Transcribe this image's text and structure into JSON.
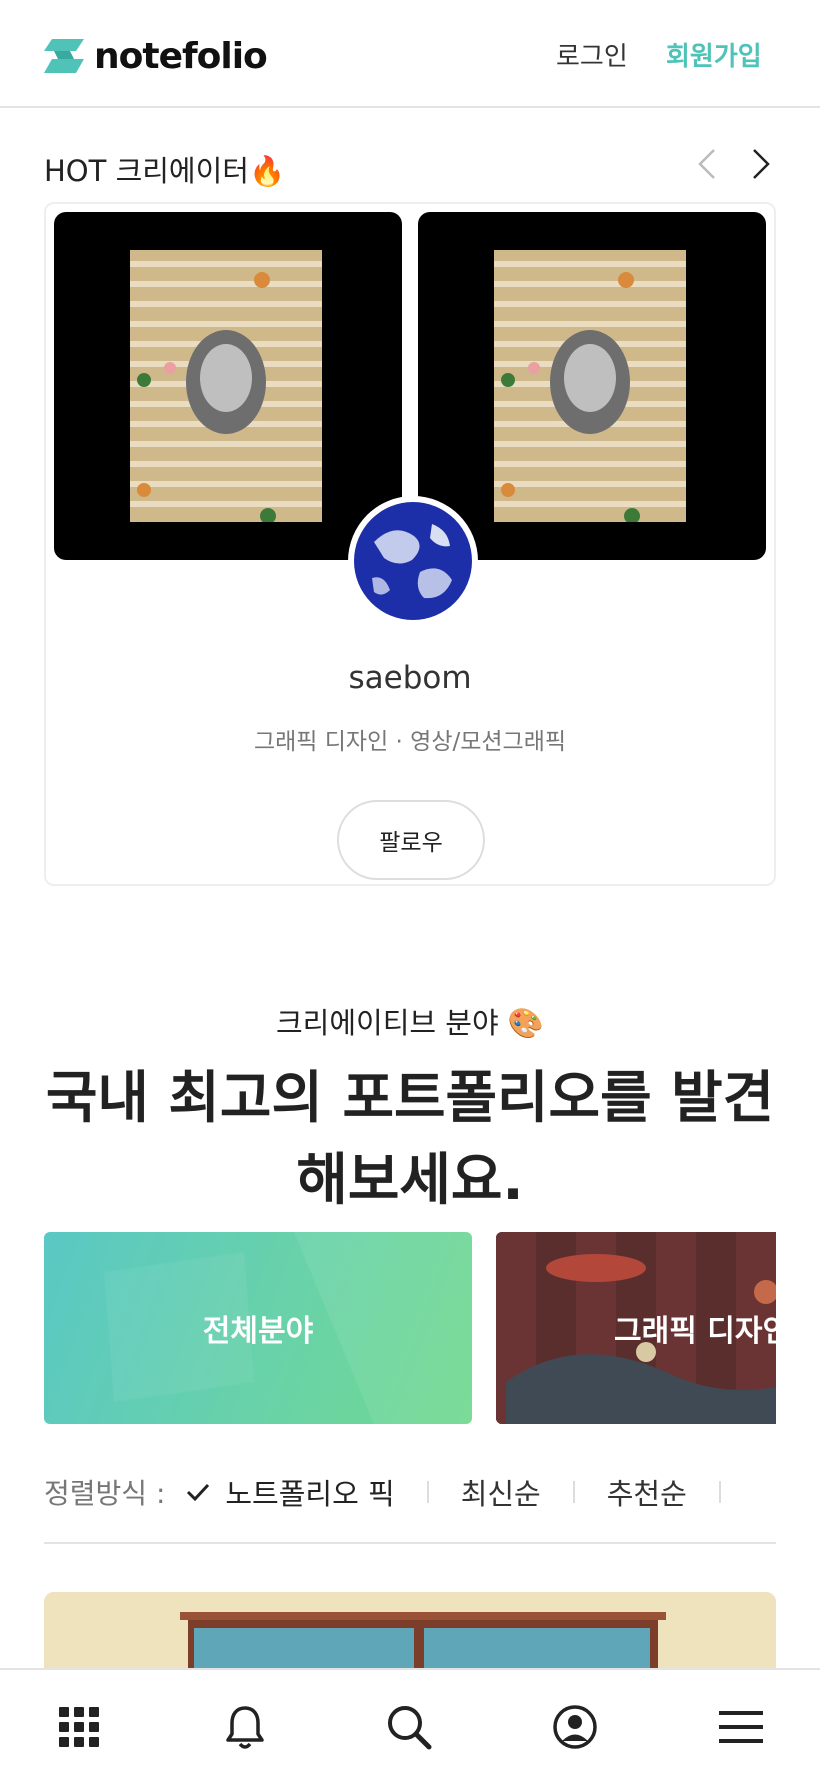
{
  "header": {
    "logo_text": "notefolio",
    "login_label": "로그인",
    "signup_label": "회원가입",
    "accent_color": "#4fc3b7"
  },
  "hot_creators": {
    "title": "HOT 크리에이터🔥",
    "creator": {
      "name": "saebom",
      "fields": "그래픽 디자인 · 영상/모션그래픽",
      "follow_label": "팔로우"
    }
  },
  "creative_fields": {
    "subtitle": "크리에이티브 분야 🎨",
    "title_line1": "국내 최고의 포트폴리오를 발견",
    "title_line2": "해보세요.",
    "tiles": [
      {
        "label": "전체분야"
      },
      {
        "label": "그래픽 디자인"
      }
    ]
  },
  "sort": {
    "label": "정렬방식 :",
    "options": [
      {
        "label": "노트폴리오 픽",
        "selected": true
      },
      {
        "label": "최신순",
        "selected": false
      },
      {
        "label": "추천순",
        "selected": false
      }
    ]
  },
  "bottom_nav": {
    "items": [
      "grid-icon",
      "bell-icon",
      "search-icon",
      "user-icon",
      "menu-icon"
    ]
  }
}
